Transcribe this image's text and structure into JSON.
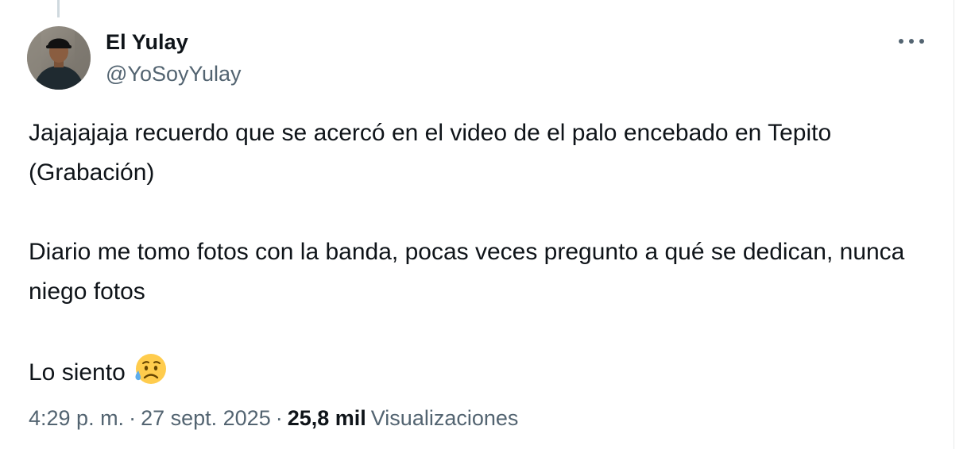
{
  "author": {
    "display_name": "El Yulay",
    "handle": "@YoSoyYulay"
  },
  "tweet": {
    "paragraphs": [
      "Jajajajaja recuerdo que se acercó en el video de el palo encebado en Tepito (Grabación)",
      "Diario me tomo fotos con la banda, pocas veces pregunto a qué se dedican, nunca niego fotos",
      "Lo siento"
    ],
    "emoji": "sad-but-relieved-face"
  },
  "meta": {
    "time": "4:29 p. m.",
    "separator": "·",
    "date": "27 sept. 2025",
    "views_count": "25,8 mil",
    "views_label": "Visualizaciones"
  },
  "icons": {
    "more": "more-horizontal-icon"
  },
  "colors": {
    "text_primary": "#0f1419",
    "text_secondary": "#536471",
    "border": "#e7e9ea",
    "thread_line": "#cfd9de"
  }
}
